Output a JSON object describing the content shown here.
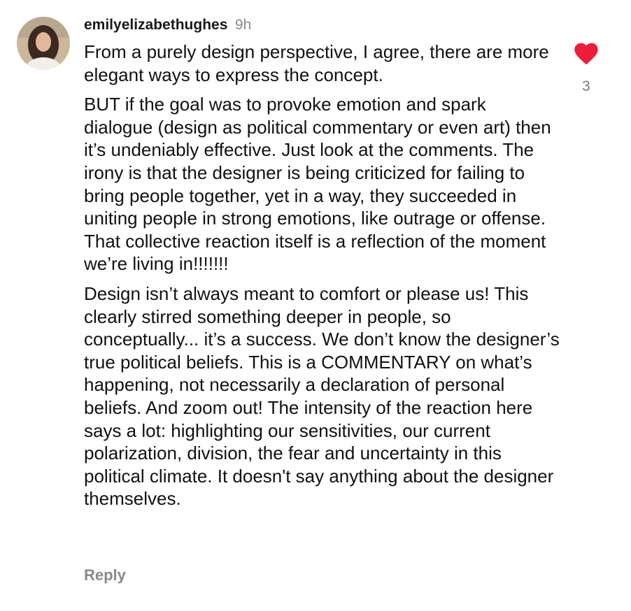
{
  "comment": {
    "username": "emilyelizabethughes",
    "time": "9h",
    "paragraphs": [
      "From a purely design perspective, I agree, there are more elegant ways to express the concept.",
      "BUT if the goal was to provoke emotion and spark dialogue (design as political commentary or even art) then it’s undeniably effective. Just look at the comments. The irony is that the designer is being criticized for failing to bring people together, yet in a way, they succeeded in uniting people in strong emotions, like outrage or offense. That collective reaction itself is a reflection of the moment we’re living in!!!!!!!",
      "Design isn’t always meant to comfort or please us! This clearly stirred something deeper in people, so conceptually... it’s a success. We don’t know the designer’s true political beliefs. This is a COMMENTARY on what’s happening, not necessarily a declaration of personal beliefs. And zoom out! The intensity of the reaction here says a lot: highlighting our sensitivities, our current polarization, division, the fear and uncertainty in this political climate. It doesn't say anything about the designer themselves."
    ],
    "reply_label": "Reply",
    "like_count": "3",
    "like_icon": "heart-filled-icon",
    "like_color": "#ee1d3a"
  }
}
